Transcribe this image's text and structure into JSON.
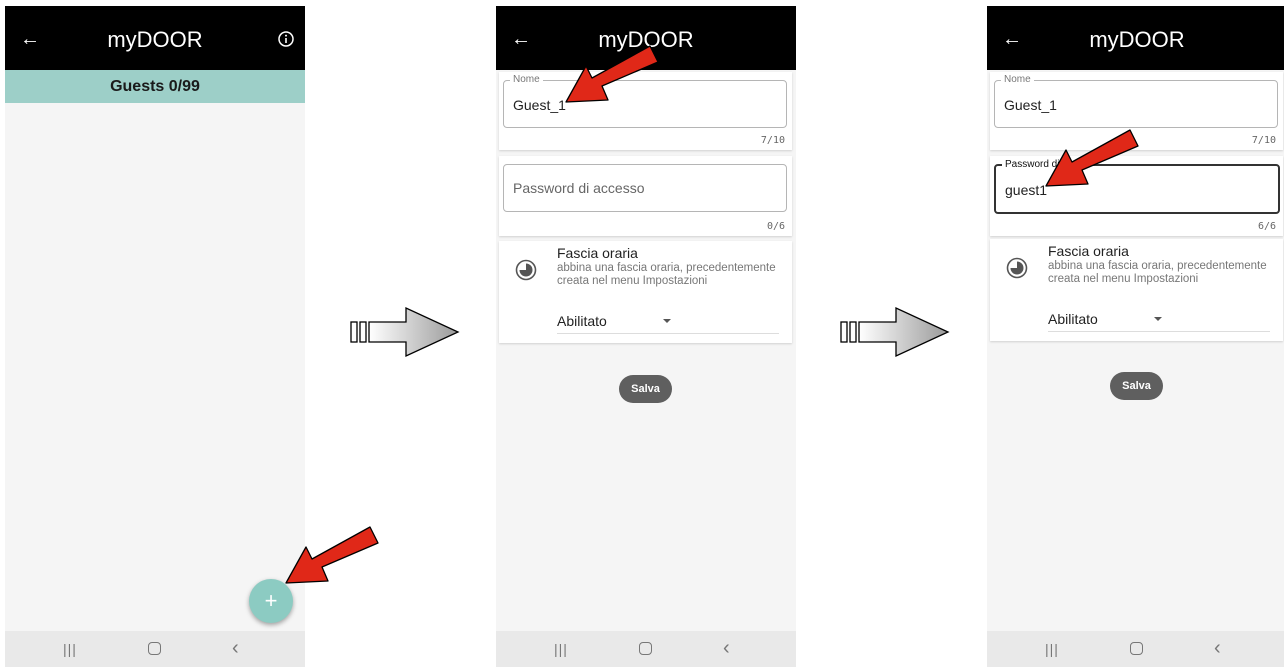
{
  "app": {
    "logo_text": "myDOOR"
  },
  "screen1": {
    "guests_label": "Guests 0/99",
    "fab_label": "+"
  },
  "screen2": {
    "name_field": {
      "label": "Nome",
      "value": "Guest_1",
      "counter": "7/10"
    },
    "password_field": {
      "placeholder": "Password di accesso",
      "counter": "0/6"
    },
    "timezone": {
      "title": "Fascia oraria",
      "description": "abbina una fascia oraria, precedentemente creata nel menu Impostazioni",
      "selected": "Abilitato"
    },
    "save_label": "Salva"
  },
  "screen3": {
    "name_field": {
      "label": "Nome",
      "value": "Guest_1",
      "counter": "7/10"
    },
    "password_field": {
      "label": "Password di",
      "value": "guest1",
      "counter": "6/6"
    },
    "timezone": {
      "title": "Fascia oraria",
      "description": "abbina una fascia oraria, precedentemente creata nel menu Impostazioni",
      "selected": "Abilitato"
    },
    "save_label": "Salva"
  },
  "icons": {
    "back": "arrow-left-icon",
    "info": "info-circle-icon",
    "timezone": "clock-icon",
    "nav_recent": "recent-apps-icon",
    "nav_home": "home-icon",
    "nav_back": "chevron-left-icon",
    "annotation": "red-pointer-arrow",
    "flow": "flow-arrow"
  },
  "colors": {
    "appbar": "#000000",
    "guests_bar": "#9dcfc8",
    "fab": "#8ccbc2",
    "save_button": "#5f5f5f",
    "annotation_arrow": "#e02818"
  }
}
